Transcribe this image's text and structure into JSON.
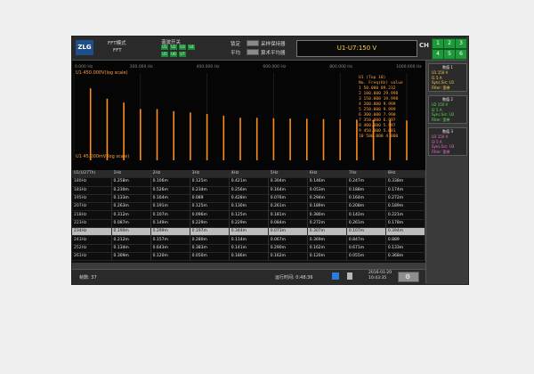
{
  "toolbar": {
    "logo": "ZLG",
    "mode_label": "FFT模式",
    "mode_value": "FFT",
    "harmonic_label": "谐波开关",
    "harmonic_channels": [
      "U1",
      "U2",
      "U3",
      "U4",
      "U5",
      "U6",
      "U7"
    ],
    "hold_label": "锁定",
    "hold_option": "采样保持器",
    "average_label": "平均",
    "average_option": "算术平均器",
    "readout": "U1-U7:150 V",
    "ch_label": "CH",
    "channel_buttons": [
      "1",
      "2",
      "3",
      "4",
      "5",
      "6"
    ]
  },
  "chart": {
    "top_ticks": [
      "0.000 Hz",
      "200.000 Hz",
      "400.000 Hz",
      "600.000 Hz",
      "800.000 Hz",
      "1000.000 Hz"
    ],
    "scale_top": "U1   450.000V(log scale)",
    "scale_bottom": "U1   45.000mV(log scale)",
    "colors": {
      "bar": "#ff8c1a",
      "bg": "#050505",
      "text": "#ffa040"
    },
    "peak_table": {
      "title": "U1   (Top 10)",
      "header": "No.   Freq(Hz)   value",
      "rows": [
        "1    50.000     89.232",
        "2    100.000    29.998",
        "3    150.000    19.998",
        "4    200.000    9.999",
        "5    250.000    9.999",
        "6    300.000    7.998",
        "7    350.000    6.997",
        "8    400.000    5.997",
        "9    450.000    5.001",
        "10   500.000    4.000"
      ]
    }
  },
  "chart_data": {
    "type": "bar",
    "xlabel": "",
    "ylabel": "",
    "xlim": [
      0,
      1000
    ],
    "log_scale": true,
    "series": [
      {
        "x": [
          50,
          100,
          150,
          200,
          250,
          300,
          350,
          400,
          450,
          500,
          550,
          600,
          650,
          700,
          750,
          800,
          850,
          900,
          950,
          1000
        ],
        "values": [
          89.232,
          29.998,
          19.998,
          9.999,
          9.999,
          7.998,
          6.997,
          5.997,
          5.001,
          4.0,
          4.0,
          3.8,
          3.7,
          3.6,
          3.5,
          3.4,
          3.3,
          3.2,
          3.1,
          3.0
        ]
      }
    ]
  },
  "side_panel": [
    {
      "title": "数值 1",
      "lines": [
        "U1     150 V",
        "I1      5 A",
        "Sync.Src: U1",
        "Filter: 宽带"
      ],
      "color": "#ffd24a"
    },
    {
      "title": "数值 2",
      "lines": [
        "U2     150 V",
        "I2      5 A",
        "Sync.Src: U2",
        "Filter: 宽带"
      ],
      "color": "#5ae05a"
    },
    {
      "title": "数值 3",
      "lines": [
        "U3     150 V",
        "I3      5 A",
        "Sync.Src: U3",
        "Filter: 宽带"
      ],
      "color": "#ff6ad5"
    }
  ],
  "table": {
    "headers": [
      "U1(U27Th)",
      "1Hz",
      "2Hz",
      "3Hz",
      "4Hz",
      "5Hz",
      "6Hz",
      "7Hz",
      "8Hz"
    ],
    "rows": [
      [
        "180Hz",
        "0.258m",
        "0.106m",
        "0.125m",
        "0.421m",
        "0.304m",
        "0.146m",
        "0.247m",
        "0.338m"
      ],
      [
        "183Hz",
        "0.230m",
        "0.526m",
        "0.234m",
        "0.256m",
        "0.164m",
        "0.053m",
        "0.188m",
        "0.174m"
      ],
      [
        "195Hz",
        "0.133m",
        "0.164m",
        "0.089",
        "0.428m",
        "0.076m",
        "0.294m",
        "0.164m",
        "0.272m"
      ],
      [
        "207Hz",
        "0.263m",
        "0.191m",
        "0.125m",
        "0.130m",
        "0.261m",
        "0.189m",
        "0.208m",
        "0.189m"
      ],
      [
        "218Hz",
        "0.312m",
        "0.107m",
        "0.096m",
        "0.125m",
        "0.181m",
        "0.380m",
        "0.142m",
        "0.221m"
      ],
      [
        "223Hz",
        "0.087m",
        "0.149m",
        "0.229m",
        "0.229m",
        "0.084m",
        "0.272m",
        "0.261m",
        "0.178m"
      ],
      [
        "234Hz",
        "0.190m",
        "0.299m",
        "0.197m",
        "0.344m",
        "0.073m",
        "0.307m",
        "0.107m",
        "0.394m"
      ],
      [
        "243Hz",
        "0.212m",
        "0.157m",
        "0.280m",
        "0.114m",
        "0.067m",
        "0.369m",
        "0.847m",
        "0.889"
      ],
      [
        "252Hz",
        "0.134m",
        "0.643m",
        "0.383m",
        "0.141m",
        "0.290m",
        "0.162m",
        "0.671m",
        "0.133m"
      ],
      [
        "261Hz",
        "0.309m",
        "0.120m",
        "0.050m",
        "0.186m",
        "0.162m",
        "0.120m",
        "0.055m",
        "0.368m"
      ]
    ],
    "highlight_row": 6
  },
  "status": {
    "frame_label": "帧数: 37",
    "run_time": "运行时间: 0:48:36",
    "date": "2016-01-20",
    "time": "10:43:35"
  }
}
